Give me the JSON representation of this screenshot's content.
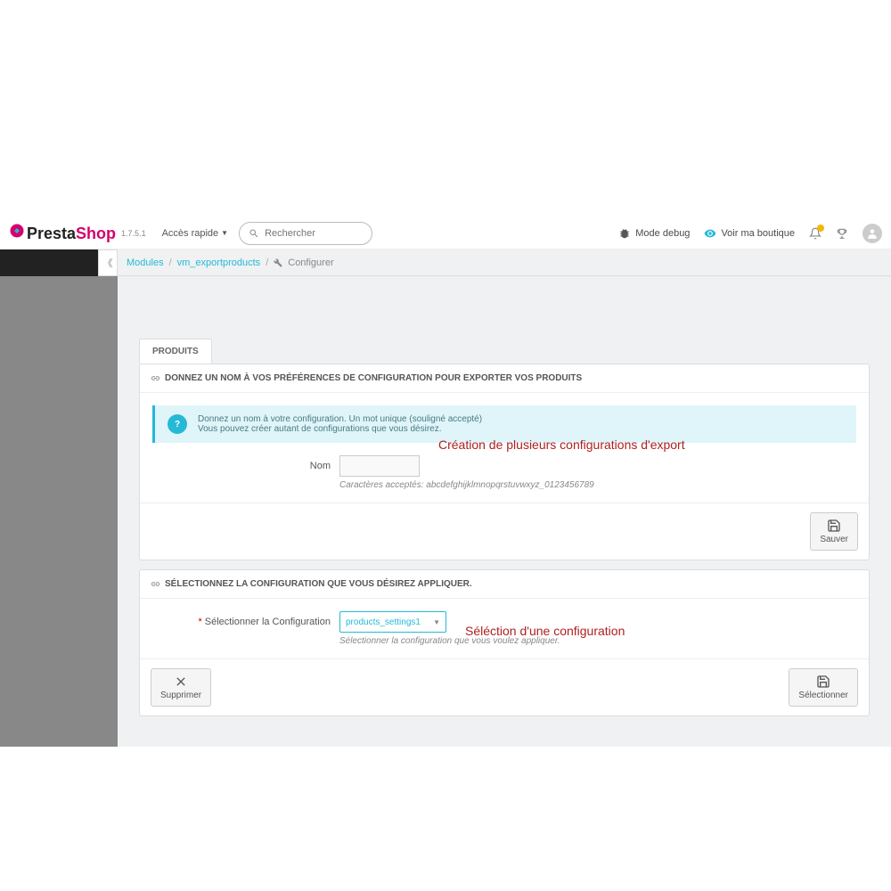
{
  "header": {
    "logo_presta": "Presta",
    "logo_shop": "Shop",
    "version": "1.7.5.1",
    "quick_access": "Accès rapide",
    "search_placeholder": "Rechercher",
    "mode_debug": "Mode debug",
    "view_shop": "Voir ma boutique"
  },
  "breadcrumb": {
    "item1": "Modules",
    "item2": "vm_exportproducts",
    "item3": "Configurer"
  },
  "tabs": {
    "products": "PRODUITS"
  },
  "panel1": {
    "title": "DONNEZ UN NOM À VOS PRÉFÉRENCES DE CONFIGURATION POUR EXPORTER VOS PRODUITS",
    "alert_l1": "Donnez un nom à votre configuration. Un mot unique (souligné accepté)",
    "alert_l2": "Vous pouvez créer autant de configurations que vous désirez.",
    "label_nom": "Nom",
    "help": "Caractères acceptés: abcdefghijklmnopqrstuvwxyz_0123456789",
    "save_btn": "Sauver",
    "annotation": "Création de plusieurs configurations d'export"
  },
  "panel2": {
    "title": "SÉLECTIONNEZ LA CONFIGURATION QUE VOUS DÉSIREZ APPLIQUER.",
    "label_select": "Sélectionner la Configuration",
    "select_value": "products_settings1",
    "help": "Sélectionner la configuration que vous voulez appliquer.",
    "delete_btn": "Supprimer",
    "select_btn": "Sélectionner",
    "annotation": "Séléction d'une configuration"
  }
}
